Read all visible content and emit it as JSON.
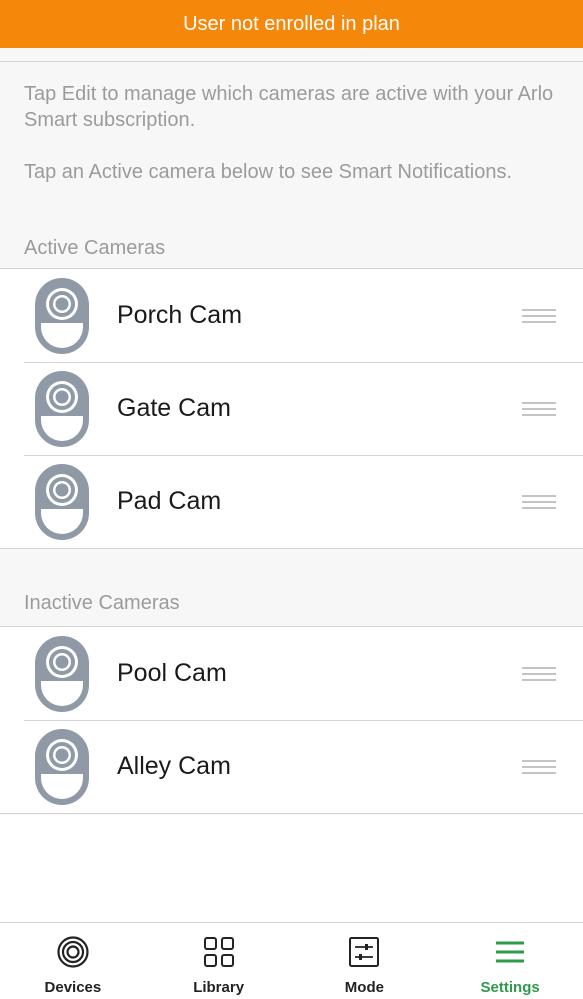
{
  "banner": {
    "text": "User not enrolled in plan",
    "color": "#f5870a"
  },
  "info": {
    "paragraph1": "Tap Edit to manage which cameras are active with your Arlo Smart subscription.",
    "paragraph2": "Tap an Active camera below to see Smart Notifications."
  },
  "active_section": {
    "label": "Active Cameras",
    "cameras": [
      {
        "name": "Porch Cam",
        "icon": "camera-icon"
      },
      {
        "name": "Gate Cam",
        "icon": "camera-icon"
      },
      {
        "name": "Pad Cam",
        "icon": "camera-icon"
      }
    ]
  },
  "inactive_section": {
    "label": "Inactive Cameras",
    "cameras": [
      {
        "name": "Pool Cam",
        "icon": "camera-icon"
      },
      {
        "name": "Alley Cam",
        "icon": "camera-icon"
      }
    ]
  },
  "tabbar": {
    "tabs": [
      {
        "label": "Devices",
        "icon": "devices-icon",
        "active": false
      },
      {
        "label": "Library",
        "icon": "library-grid-icon",
        "active": false
      },
      {
        "label": "Mode",
        "icon": "mode-sliders-icon",
        "active": false
      },
      {
        "label": "Settings",
        "icon": "settings-menu-icon",
        "active": true
      }
    ],
    "active_color": "#2e9a4c"
  }
}
